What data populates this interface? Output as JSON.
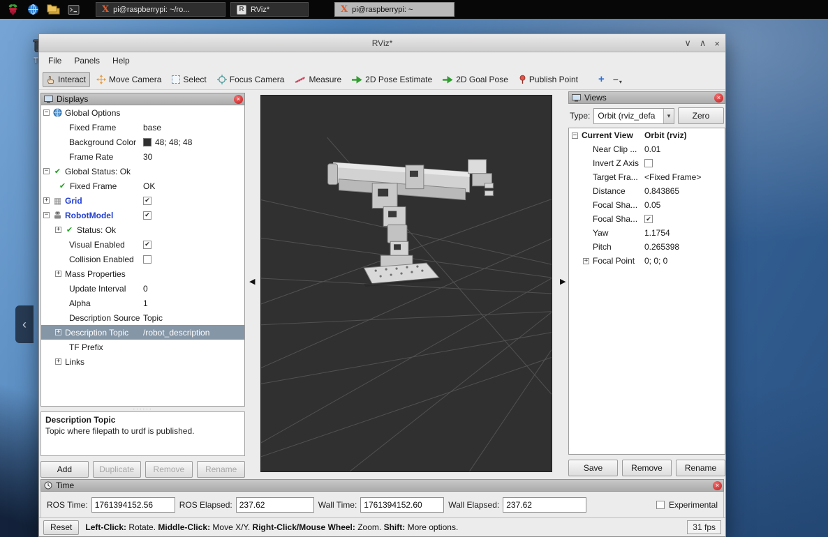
{
  "icons": {
    "close": "×",
    "window_shade": "∨",
    "window_unshade": "∧",
    "dropdown_arrow": "▾",
    "splitter_left": "◀",
    "splitter_right": "▶",
    "splitter_dots": "······",
    "check": "✔",
    "grid_glyph": "▦",
    "expander_open": "−",
    "expander_closed": "+",
    "plus_tool": "+",
    "minus_tool": "−",
    "xterm": "X",
    "rviz_logo": "R",
    "handle_chevron": "‹"
  },
  "desktop": {
    "trash_label": "Tra"
  },
  "taskbar": {
    "buttons": [
      {
        "label": "pi@raspberrypi: ~/ro..."
      },
      {
        "label": "RViz*"
      },
      {
        "label": "pi@raspberrypi: ~"
      }
    ]
  },
  "titlebar": {
    "title": "RViz*"
  },
  "menu": {
    "items": [
      "File",
      "Panels",
      "Help"
    ]
  },
  "toolbar": {
    "tools": [
      "Interact",
      "Move Camera",
      "Select",
      "Focus Camera",
      "Measure",
      "2D Pose Estimate",
      "2D Goal Pose",
      "Publish Point"
    ]
  },
  "displays": {
    "header": "Displays",
    "rows": [
      {
        "label": "Global Options",
        "value": ""
      },
      {
        "label": "Fixed Frame",
        "value": "base"
      },
      {
        "label": "Background Color",
        "value": "48; 48; 48"
      },
      {
        "label": "Frame Rate",
        "value": "30"
      },
      {
        "label": "Global Status: Ok",
        "value": ""
      },
      {
        "label": "Fixed Frame",
        "value": "OK"
      },
      {
        "label": "Grid",
        "value": ""
      },
      {
        "label": "RobotModel",
        "value": ""
      },
      {
        "label": "Status: Ok",
        "value": ""
      },
      {
        "label": "Visual Enabled",
        "value": ""
      },
      {
        "label": "Collision Enabled",
        "value": ""
      },
      {
        "label": "Mass Properties",
        "value": ""
      },
      {
        "label": "Update Interval",
        "value": "0"
      },
      {
        "label": "Alpha",
        "value": "1"
      },
      {
        "label": "Description Source",
        "value": "Topic"
      },
      {
        "label": "Description Topic",
        "value": "/robot_description"
      },
      {
        "label": "TF Prefix",
        "value": ""
      },
      {
        "label": "Links",
        "value": ""
      }
    ],
    "help_title": "Description Topic",
    "help_text": "Topic where filepath to urdf is published.",
    "buttons": {
      "add": "Add",
      "duplicate": "Duplicate",
      "remove": "Remove",
      "rename": "Rename"
    }
  },
  "views": {
    "header": "Views",
    "type_label": "Type:",
    "type_value": "Orbit (rviz_defa",
    "zero_button": "Zero",
    "rows": [
      {
        "label": "Current View",
        "value": "Orbit (rviz)"
      },
      {
        "label": "Near Clip ...",
        "value": "0.01"
      },
      {
        "label": "Invert Z Axis",
        "value": ""
      },
      {
        "label": "Target Fra...",
        "value": "<Fixed Frame>"
      },
      {
        "label": "Distance",
        "value": "0.843865"
      },
      {
        "label": "Focal Sha...",
        "value": "0.05"
      },
      {
        "label": "Focal Sha...",
        "value": ""
      },
      {
        "label": "Yaw",
        "value": "1.1754"
      },
      {
        "label": "Pitch",
        "value": "0.265398"
      },
      {
        "label": "Focal Point",
        "value": "0; 0; 0"
      }
    ],
    "buttons": {
      "save": "Save",
      "remove": "Remove",
      "rename": "Rename"
    }
  },
  "time": {
    "header": "Time",
    "fields": [
      {
        "label": "ROS Time:",
        "value": "1761394152.56"
      },
      {
        "label": "ROS Elapsed:",
        "value": "237.62"
      },
      {
        "label": "Wall Time:",
        "value": "1761394152.60"
      },
      {
        "label": "Wall Elapsed:",
        "value": "237.62"
      }
    ],
    "experimental_label": "Experimental"
  },
  "statusbar": {
    "reset_button": "Reset",
    "segments": [
      {
        "b": "Left-Click:",
        "t": " Rotate.  "
      },
      {
        "b": "Middle-Click:",
        "t": " Move X/Y.  "
      },
      {
        "b": "Right-Click/Mouse Wheel:",
        "t": " Zoom.  "
      },
      {
        "b": "Shift:",
        "t": " More options."
      }
    ],
    "fps": "31 fps"
  }
}
